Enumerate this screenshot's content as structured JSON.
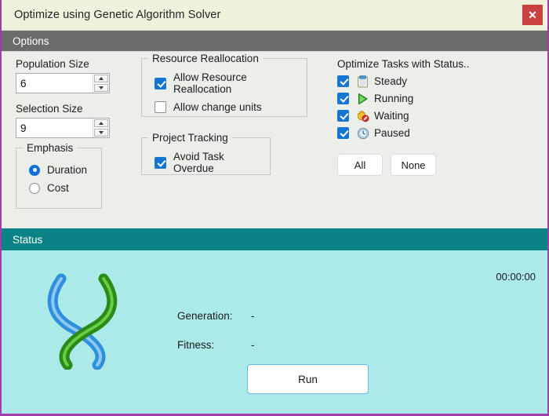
{
  "window": {
    "title": "Optimize using Genetic Algorithm Solver",
    "close_label": "✕"
  },
  "options": {
    "header": "Options",
    "population": {
      "label": "Population Size",
      "value": "6"
    },
    "selection": {
      "label": "Selection Size",
      "value": "9"
    },
    "emphasis": {
      "title": "Emphasis",
      "options": [
        {
          "label": "Duration",
          "checked": true
        },
        {
          "label": "Cost",
          "checked": false
        }
      ]
    },
    "resource_reallocation": {
      "title": "Resource Reallocation",
      "options": [
        {
          "label": "Allow Resource Reallocation",
          "checked": true
        },
        {
          "label": "Allow change units",
          "checked": false
        }
      ]
    },
    "project_tracking": {
      "title": "Project Tracking",
      "options": [
        {
          "label": "Avoid Task Overdue",
          "checked": true
        }
      ]
    },
    "task_status": {
      "title": "Optimize Tasks with Status..",
      "items": [
        {
          "label": "Steady",
          "icon": "clipboard-icon",
          "checked": true
        },
        {
          "label": "Running",
          "icon": "play-triangle-icon",
          "checked": true
        },
        {
          "label": "Waiting",
          "icon": "hand-stop-icon",
          "checked": true
        },
        {
          "label": "Paused",
          "icon": "clock-icon",
          "checked": true
        }
      ],
      "all_label": "All",
      "none_label": "None"
    }
  },
  "status": {
    "header": "Status",
    "timer": "00:00:00",
    "generation_label": "Generation:",
    "generation_value": "-",
    "fitness_label": "Fitness:",
    "fitness_value": "-",
    "run_label": "Run",
    "logo": "dna-helix-logo"
  },
  "colors": {
    "titlebar_bg": "#eef2dd",
    "close_bg": "#c9423f",
    "options_header_bg": "#6b6b6b",
    "status_header_bg": "#0b8285",
    "status_body_bg": "#ace9e9",
    "accent_blue": "#1576d2",
    "window_border": "#a23ca8",
    "dna_blue": "#2e8fdc",
    "dna_green": "#3faa2a"
  }
}
